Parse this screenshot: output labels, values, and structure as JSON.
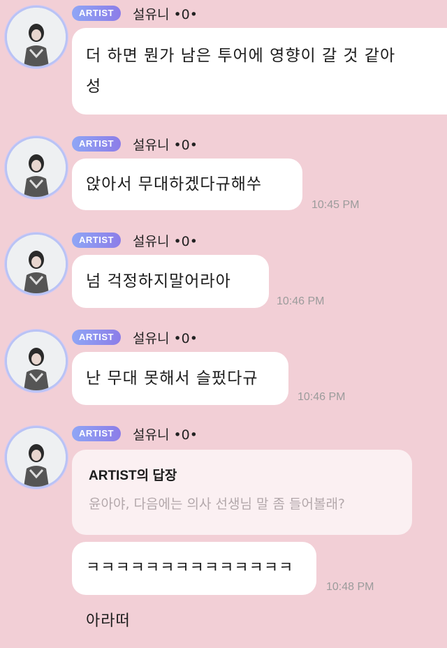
{
  "artist_badge": "ARTIST",
  "sender_name": "설유니 •0•",
  "messages": [
    {
      "text_line1": "더 하면 뭔가 남은 투어에 영향이 갈 것 같아",
      "text_line2": "성",
      "time": ""
    },
    {
      "text": "앉아서 무대하겠다규해쑤",
      "time": "10:45 PM"
    },
    {
      "text": "넘 걱정하지말어라아",
      "time": "10:46 PM"
    },
    {
      "text": "난 무대 못해서 슬펐다규",
      "time": "10:46 PM"
    },
    {
      "reply_title": "ARTIST의 답장",
      "reply_text": "윤아야, 다음에는 의사 선생님 말 좀 들어볼래?",
      "text": "ㅋㅋㅋㅋㅋㅋㅋㅋㅋㅋㅋㅋㅋㅋ 아라떠",
      "time": "10:48 PM"
    }
  ]
}
